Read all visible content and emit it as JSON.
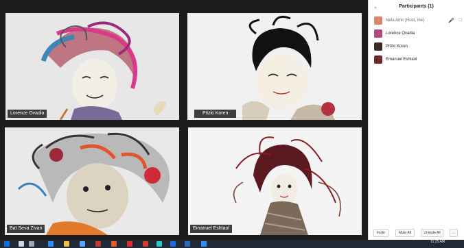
{
  "participants_panel": {
    "title": "Participants (1)",
    "collapse_icon": "chevron-down-icon",
    "participants": [
      {
        "name": "Neta Amir (Host, me)",
        "avatar_color": "#d9896b"
      },
      {
        "name": "Lorence Ovadia",
        "avatar_color": "#b04a7a"
      },
      {
        "name": "Pitzki Koren",
        "avatar_color": "#3b2a26"
      },
      {
        "name": "Emanuel Eshtaol",
        "avatar_color": "#6e2a2a"
      }
    ],
    "buttons": {
      "invite": "Invite",
      "mute_all": "Mute All",
      "unmute_all": "Unmute All",
      "more": "..."
    }
  },
  "video_tiles": [
    {
      "name": "Lorence Ovadia"
    },
    {
      "name": "Pitzki Koren"
    },
    {
      "name": "Bat Seva Zivan"
    },
    {
      "name": "Emanuel Eshtaol"
    }
  ],
  "taskbar": {
    "time": "11:25 AM"
  },
  "colors": {
    "accent": "#2d8cff",
    "panel_bg": "#ffffff",
    "gallery_bg": "#1c1c1c",
    "taskbar_bg": "#1f2a36"
  }
}
